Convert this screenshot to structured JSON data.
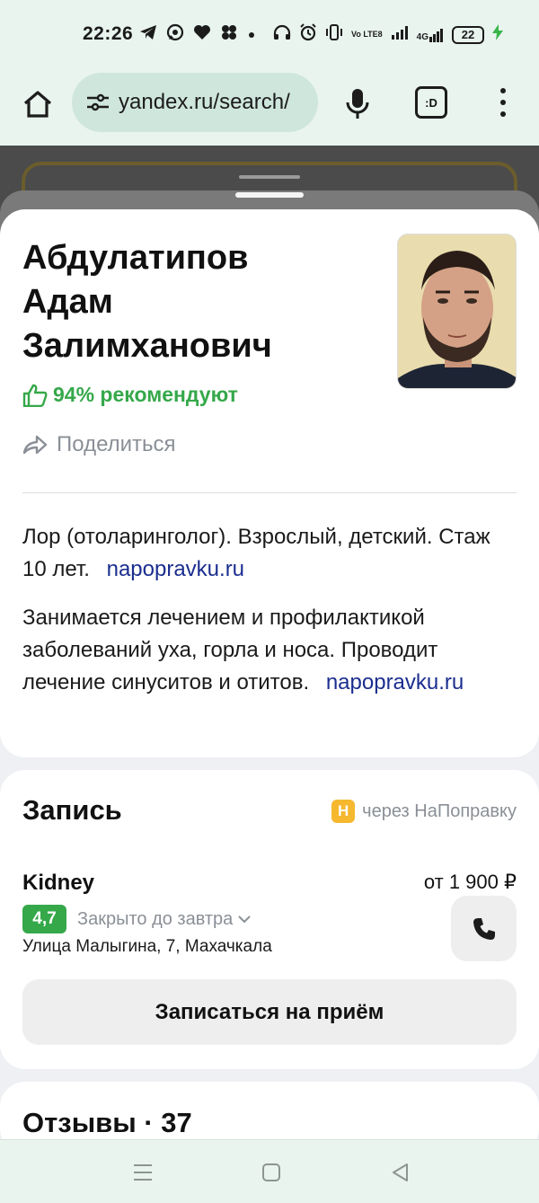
{
  "status_bar": {
    "time": "22:26",
    "battery": "22",
    "signal_labels": [
      "Vo LTE8",
      "4G"
    ],
    "left_icons": [
      "telegram-icon",
      "whatsapp-icon",
      "heart-icon",
      "clover-icon",
      "dot-icon"
    ],
    "right_icons": [
      "headphones-icon",
      "alarm-icon",
      "vibrate-icon",
      "volte-icon",
      "signal-icon",
      "4g-signal-icon",
      "battery-icon",
      "charging-icon"
    ]
  },
  "browser": {
    "url": "yandex.ru/search/",
    "tab_label": ":D"
  },
  "profile": {
    "name_lines": [
      "Абдулатипов",
      "Адам",
      "Залимханович"
    ],
    "recommend": "94% рекомендуют",
    "share": "Поделиться",
    "description1": "Лор (отоларинголог). Взрослый, детский. Стаж 10 лет.",
    "description2": "Занимается лечением и профилактикой заболеваний уха, горла и носа. Проводит лечение синуситов и отитов.",
    "source": "napopravku.ru"
  },
  "booking": {
    "title": "Запись",
    "via_badge": "Н",
    "via_label": "через НаПоправку",
    "clinic": "Kidney",
    "price": "от 1 900 ₽",
    "rating": "4,7",
    "hours": "Закрыто до завтра",
    "address": "Улица Малыгина, 7, Махачкала",
    "button": "Записаться на приём"
  },
  "reviews": {
    "title": "Отзывы · 37"
  },
  "colors": {
    "accent_green": "#35a84a",
    "link_blue": "#1b2e8f",
    "badge_orange": "#f5b82e",
    "chrome_bg": "#e9f4ef"
  }
}
